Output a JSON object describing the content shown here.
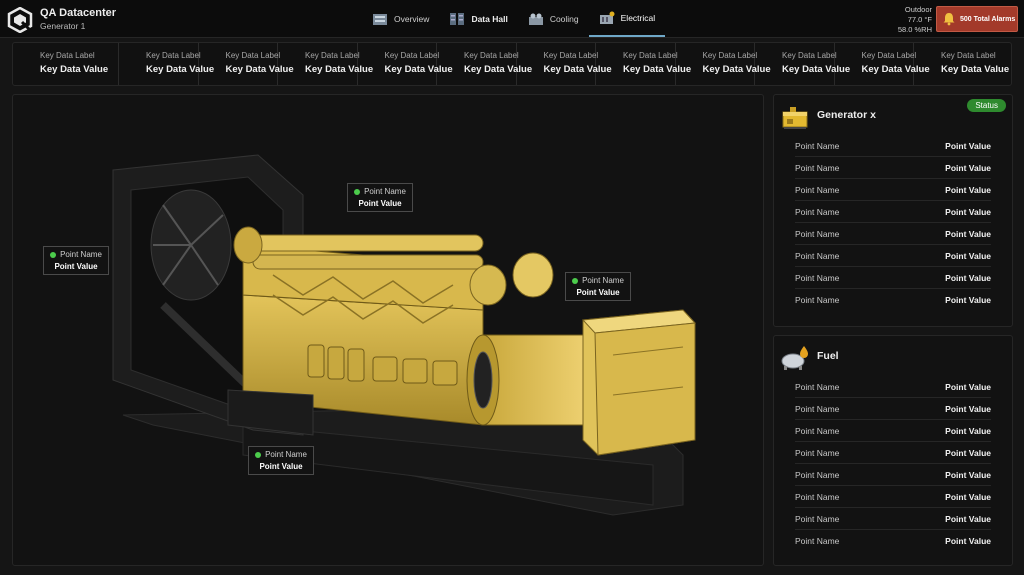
{
  "header": {
    "title": "QA Datacenter",
    "subtitle": "Generator 1",
    "logo_icon": "logo-icon",
    "tabs": [
      {
        "label": "Overview",
        "icon": "server-icon"
      },
      {
        "label": "Data Hall",
        "icon": "racks-icon"
      },
      {
        "label": "Cooling",
        "icon": "chiller-icon"
      },
      {
        "label": "Electrical",
        "icon": "electrical-icon"
      }
    ],
    "weather": {
      "label": "Outdoor",
      "temp": "77.0 °F",
      "humidity": "58.0 %RH"
    },
    "alarms": {
      "label": "500 Total Alarms",
      "icon": "bell-icon",
      "color": "#a33a2a"
    }
  },
  "kpis": [
    {
      "label": "Key Data Label",
      "value": "Key Data Value"
    },
    {
      "label": "Key Data Label",
      "value": "Key Data Value"
    },
    {
      "label": "Key Data Label",
      "value": "Key Data Value"
    },
    {
      "label": "Key Data Label",
      "value": "Key Data Value"
    },
    {
      "label": "Key Data Label",
      "value": "Key Data Value"
    },
    {
      "label": "Key Data Label",
      "value": "Key Data Value"
    },
    {
      "label": "Key Data Label",
      "value": "Key Data Value"
    },
    {
      "label": "Key Data Label",
      "value": "Key Data Value"
    },
    {
      "label": "Key Data Label",
      "value": "Key Data Value"
    },
    {
      "label": "Key Data Label",
      "value": "Key Data Value"
    },
    {
      "label": "Key Data Label",
      "value": "Key Data Value"
    },
    {
      "label": "Key Data Label",
      "value": "Key Data Value"
    }
  ],
  "callouts": [
    {
      "name": "Point Name",
      "value": "Point Value",
      "status_color": "#4ccc4c"
    },
    {
      "name": "Point Name",
      "value": "Point Value",
      "status_color": "#4ccc4c"
    },
    {
      "name": "Point Name",
      "value": "Point Value",
      "status_color": "#4ccc4c"
    },
    {
      "name": "Point Name",
      "value": "Point Value",
      "status_color": "#4ccc4c"
    }
  ],
  "generator_panel": {
    "title": "Generator x",
    "status": "Status",
    "status_color": "#2e8a2e",
    "icon": "generator-icon",
    "rows": [
      {
        "name": "Point Name",
        "value": "Point Value"
      },
      {
        "name": "Point Name",
        "value": "Point Value"
      },
      {
        "name": "Point Name",
        "value": "Point Value"
      },
      {
        "name": "Point Name",
        "value": "Point Value"
      },
      {
        "name": "Point Name",
        "value": "Point Value"
      },
      {
        "name": "Point Name",
        "value": "Point Value"
      },
      {
        "name": "Point Name",
        "value": "Point Value"
      },
      {
        "name": "Point Name",
        "value": "Point Value"
      }
    ]
  },
  "fuel_panel": {
    "title": "Fuel",
    "icon": "fuel-tank-icon",
    "rows": [
      {
        "name": "Point Name",
        "value": "Point Value"
      },
      {
        "name": "Point Name",
        "value": "Point Value"
      },
      {
        "name": "Point Name",
        "value": "Point Value"
      },
      {
        "name": "Point Name",
        "value": "Point Value"
      },
      {
        "name": "Point Name",
        "value": "Point Value"
      },
      {
        "name": "Point Name",
        "value": "Point Value"
      },
      {
        "name": "Point Name",
        "value": "Point Value"
      },
      {
        "name": "Point Name",
        "value": "Point Value"
      }
    ]
  }
}
